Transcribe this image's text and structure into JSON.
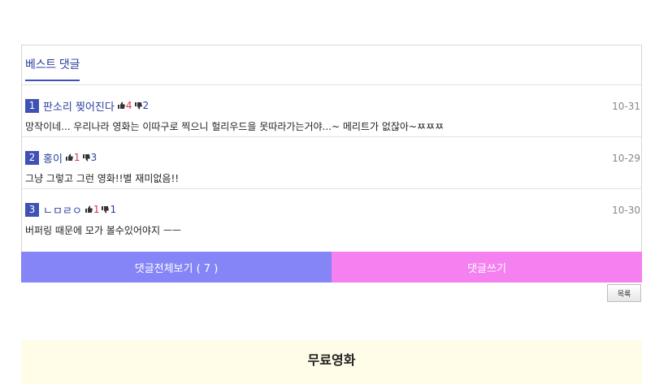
{
  "best_comments": {
    "title": "베스트 댓글",
    "items": [
      {
        "rank": "1",
        "author": "판소리 찢어진다",
        "likes": "4",
        "dislikes": "2",
        "date": "10-31",
        "text": "망작이네... 우리나라 영화는 이따구로 찍으니 헐리우드을 못따라가는거야...~ 메리트가 없잖아~ㅉㅉㅉ"
      },
      {
        "rank": "2",
        "author": "홍이",
        "likes": "1",
        "dislikes": "3",
        "date": "10-29",
        "text": "그냥 그렇고 그런 영화!!별 재미없음!!"
      },
      {
        "rank": "3",
        "author": "ㄴㅁㄹㅇ",
        "likes": "1",
        "dislikes": "1",
        "date": "10-30",
        "text": "버퍼링 때문에 모가 볼수있어야지 ㅡㅡ"
      }
    ]
  },
  "actions": {
    "view_all_label": "댓글전체보기 ( 7 )",
    "write_label": "댓글쓰기",
    "list_label": "목록"
  },
  "free_movies": {
    "title": "무료영화"
  },
  "icons": {
    "like": "thumbs-up-icon",
    "dislike": "thumbs-down-icon"
  },
  "colors": {
    "accent": "#3f51b5",
    "view_all_bg": "#8585f7",
    "write_bg": "#f481ef",
    "section_bg": "#fffde8"
  }
}
